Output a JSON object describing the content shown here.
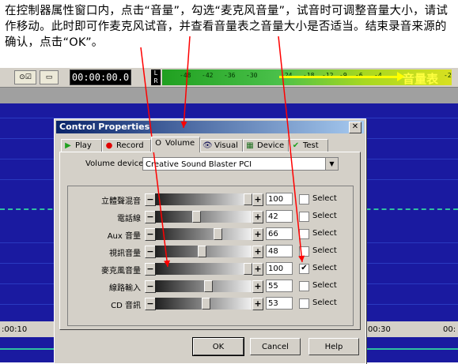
{
  "instruction": "在控制器属性窗口内，点击“音量”，勾选“麦克风音量”，试音时可调整音量大小，请试作移动。此时即可作麦克风试音，并查看音量表之音量大小是否适当。结束录音来源的确认，点击“OK”。",
  "toolbar": {
    "btn1": "⊙☑",
    "btn2": "▭",
    "time": "00:00:00.0",
    "meter_l": "L",
    "meter_r": "R",
    "meter_ticks": [
      "-48",
      "-42",
      "-36",
      "-30",
      "-24",
      "-18",
      "-12",
      "-9",
      "-6",
      "-4",
      "-2"
    ],
    "meter_label": "音量表"
  },
  "ruler": {
    "left": ":00:10",
    "right1": "00:30",
    "right2": "00:"
  },
  "dialog": {
    "title": "Control Properties",
    "close": "✕",
    "tabs": [
      {
        "icon": "▶",
        "label": "Play"
      },
      {
        "icon": "●",
        "label": "Record"
      },
      {
        "icon": "O",
        "label": "Volume"
      },
      {
        "icon": "👁",
        "label": "Visual"
      },
      {
        "icon": "▦",
        "label": "Device"
      },
      {
        "icon": "✔",
        "label": "Test"
      }
    ],
    "volume_device_label": "Volume device:",
    "volume_device_value": "Creative Sound Blaster PCI",
    "rows": [
      {
        "label": "立體聲混音",
        "value": "100",
        "checked": false,
        "select": "Select",
        "level": 1.0
      },
      {
        "label": "電話線",
        "value": "42",
        "checked": false,
        "select": "Select",
        "level": 0.42
      },
      {
        "label": "Aux 音量",
        "value": "66",
        "checked": false,
        "select": "Select",
        "level": 0.66
      },
      {
        "label": "視訊音量",
        "value": "48",
        "checked": false,
        "select": "Select",
        "level": 0.48
      },
      {
        "label": "麥克風音量",
        "value": "100",
        "checked": true,
        "select": "Select",
        "level": 1.0
      },
      {
        "label": "線路輸入",
        "value": "55",
        "checked": false,
        "select": "Select",
        "level": 0.55
      },
      {
        "label": "CD 音訊",
        "value": "53",
        "checked": false,
        "select": "Select",
        "level": 0.53
      }
    ],
    "ok": "OK",
    "cancel": "Cancel",
    "help": "Help"
  },
  "colors": {
    "annotation": "#ff0000",
    "titlebar": "#0a246a",
    "wave_bg": "#1a1aa0"
  }
}
